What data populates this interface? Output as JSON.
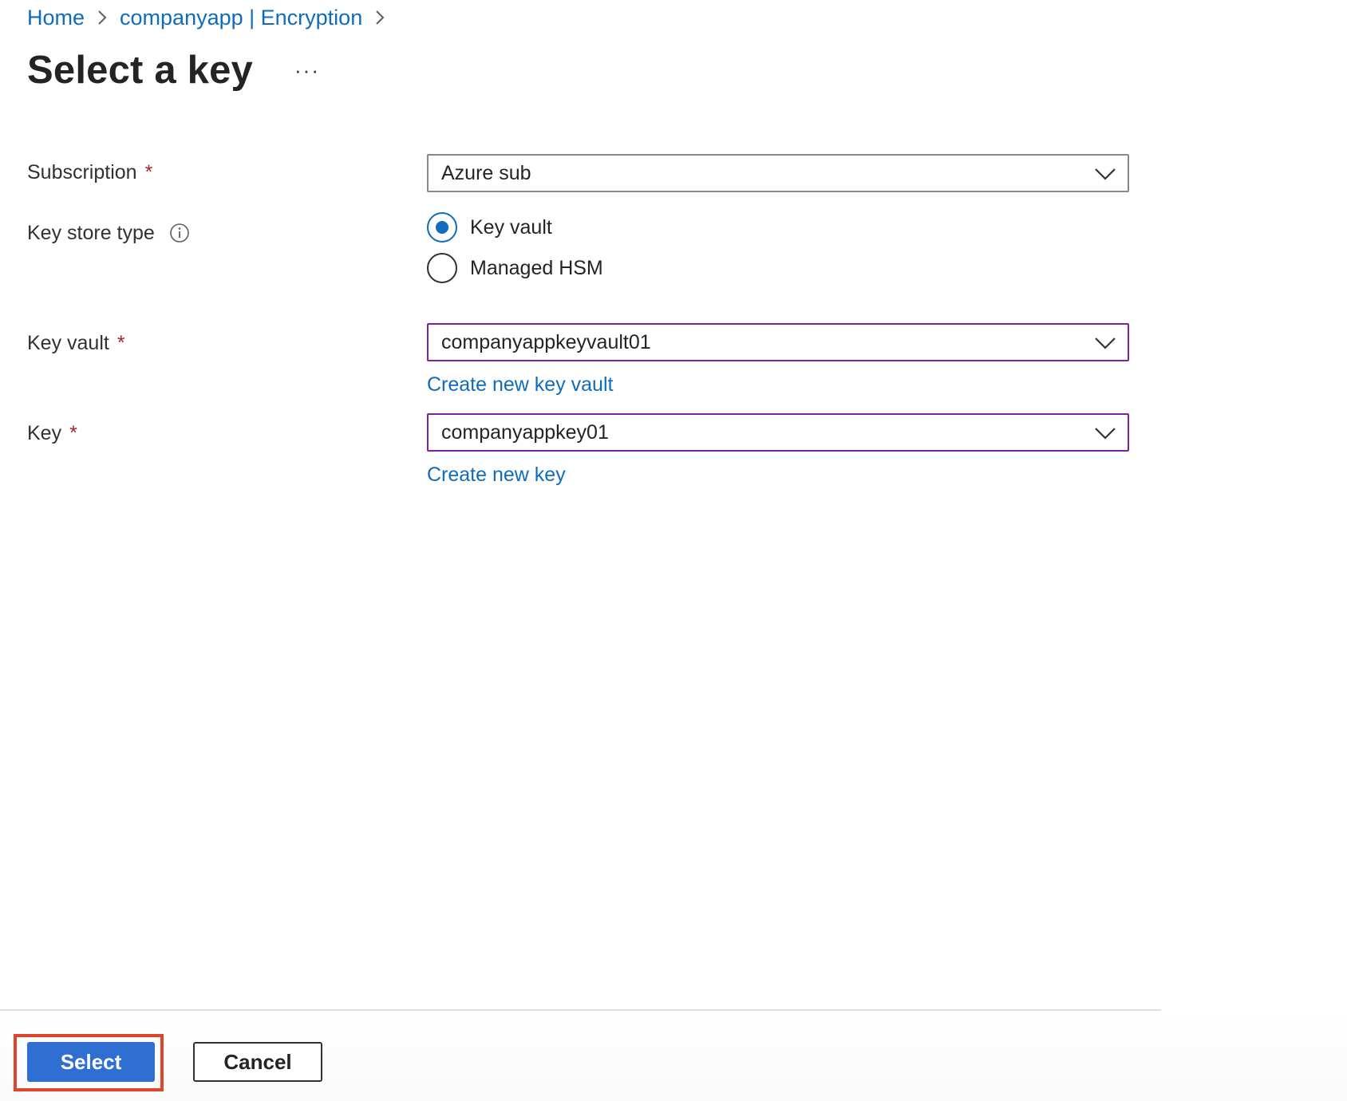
{
  "breadcrumb": {
    "items": [
      {
        "label": "Home"
      },
      {
        "label": "companyapp | Encryption"
      }
    ]
  },
  "header": {
    "title": "Select a key",
    "more_label": "···"
  },
  "form": {
    "subscription": {
      "label": "Subscription",
      "required_mark": "*",
      "value": "Azure sub"
    },
    "key_store_type": {
      "label": "Key store type",
      "options": [
        {
          "label": "Key vault",
          "checked": true
        },
        {
          "label": "Managed HSM",
          "checked": false
        }
      ]
    },
    "key_vault": {
      "label": "Key vault",
      "required_mark": "*",
      "value": "companyappkeyvault01",
      "create_link": "Create new key vault"
    },
    "key": {
      "label": "Key",
      "required_mark": "*",
      "value": "companyappkey01",
      "create_link": "Create new key"
    }
  },
  "footer": {
    "select_label": "Select",
    "cancel_label": "Cancel"
  },
  "colors": {
    "link": "#0f6cbd",
    "required": "#a4262c",
    "focus_border": "#7f1fa3",
    "primary_button": "#2f6fd1",
    "highlight": "#e0452c"
  },
  "icons": {
    "breadcrumb_separator": "chevron-right-icon",
    "dropdown": "chevron-down-icon",
    "info": "info-icon"
  }
}
